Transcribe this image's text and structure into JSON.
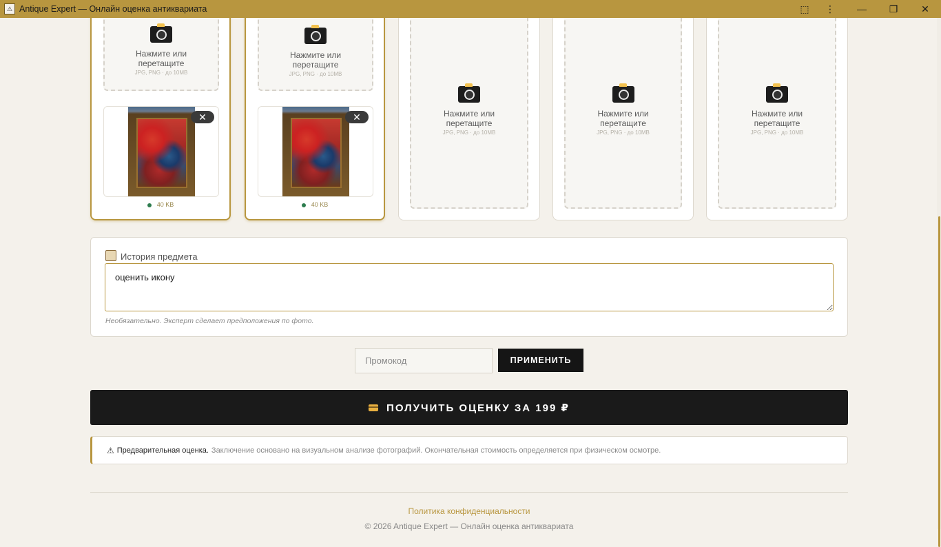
{
  "window": {
    "title": "Antique Expert — Онлайн оценка антиквариата",
    "controls": {
      "extensions": "⬚",
      "menu": "⋮",
      "minimize": "—",
      "restore": "❐",
      "close": "✕"
    }
  },
  "uploads": {
    "dropzone_text_1": "Нажмите или",
    "dropzone_text_2": "перетащите",
    "dropzone_hint": "JPG, PNG · до 10MB",
    "remove_label": "✕",
    "file_size": "40 KB"
  },
  "history": {
    "label": "История предмета",
    "value": "оценить икону",
    "help": "Необязательно. Эксперт сделает предположения по фото."
  },
  "promo": {
    "placeholder": "Промокод",
    "apply_label": "ПРИМЕНИТЬ"
  },
  "cta": {
    "label": "ПОЛУЧИТЬ ОЦЕНКУ ЗА 199 ₽"
  },
  "notice": {
    "icon": "⚠",
    "strong": "Предварительная оценка.",
    "text": "Заключение основано на визуальном анализе фотографий. Окончательная стоимость определяется при физическом осмотре."
  },
  "footer": {
    "privacy": "Политика конфиденциальности",
    "copyright": "© 2026 Antique Expert — Онлайн оценка антиквариата"
  },
  "colors": {
    "accent": "#b8963f",
    "dark": "#1a1a1a",
    "background": "#f4f1eb"
  }
}
